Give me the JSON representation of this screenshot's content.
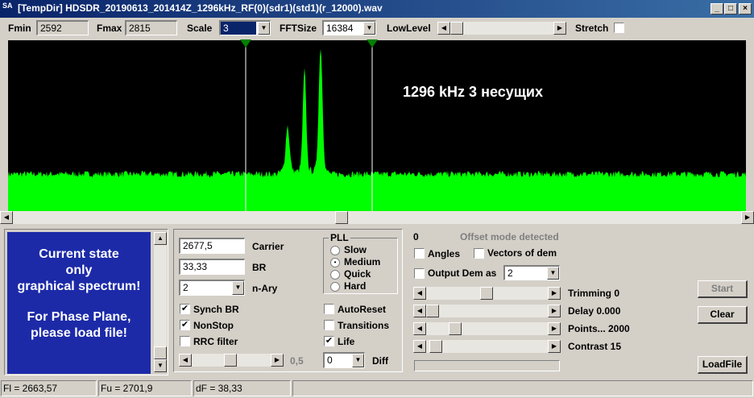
{
  "window": {
    "app_icon_text": "SA",
    "title": "[TempDir] HDSDR_20190613_201414Z_1296kHz_RF(0)(sdr1)(std1)(r_12000).wav",
    "minimize": "_",
    "maximize": "□",
    "close": "×"
  },
  "toolbar": {
    "fmin_label": "Fmin",
    "fmin_value": "2592",
    "fmax_label": "Fmax",
    "fmax_value": "2815",
    "scale_label": "Scale",
    "scale_value": "3",
    "fftsize_label": "FFTSize",
    "fftsize_value": "16384",
    "lowlevel_label": "LowLevel",
    "stretch_label": "Stretch",
    "stretch_checked": false
  },
  "spectrum": {
    "annotation": "1296 kHz 3 несущих",
    "background": "#000000",
    "trace_color": "#00ff00",
    "marker_color": "#008000"
  },
  "state_panel": {
    "line1": "Current state",
    "line2": "only",
    "line3": "graphical spectrum!",
    "line4": "For Phase Plane,",
    "line5": "please load file!",
    "background": "#1c2aa8"
  },
  "params": {
    "carrier_value": "2677,5",
    "carrier_label": "Carrier",
    "br_value": "33,33",
    "br_label": "BR",
    "nary_value": "2",
    "nary_label": "n-Ary",
    "synch_br_label": "Synch BR",
    "synch_br_checked": "✔",
    "nonstop_label": "NonStop",
    "nonstop_checked": "✔",
    "rrc_label": "RRC filter",
    "rrc_checked": "",
    "slider_value": "0,5"
  },
  "pll": {
    "title": "PLL",
    "slow": "Slow",
    "medium": "Medium",
    "quick": "Quick",
    "hard": "Hard",
    "selected_mark": "•"
  },
  "options": {
    "autoreset_label": "AutoReset",
    "transitions_label": "Transitions",
    "life_label": "Life",
    "life_checked": "✔",
    "diff_value": "0",
    "diff_label": "Diff"
  },
  "demod": {
    "zero_value": "0",
    "offset_text": "Offset mode detected",
    "angles_label": "Angles",
    "vectors_label": "Vectors of dem",
    "output_label": "Output Dem as",
    "output_value": "2",
    "trimming_label": "Trimming 0",
    "delay_label": "Delay  0.000",
    "points_label": "Points... 2000",
    "contrast_label": "Contrast 15"
  },
  "buttons": {
    "start": "Start",
    "clear": "Clear",
    "loadfile": "LoadFile"
  },
  "status": {
    "fl": "Fl = 2663,57",
    "fu": "Fu = 2701,9",
    "df": "dF = 38,33"
  }
}
